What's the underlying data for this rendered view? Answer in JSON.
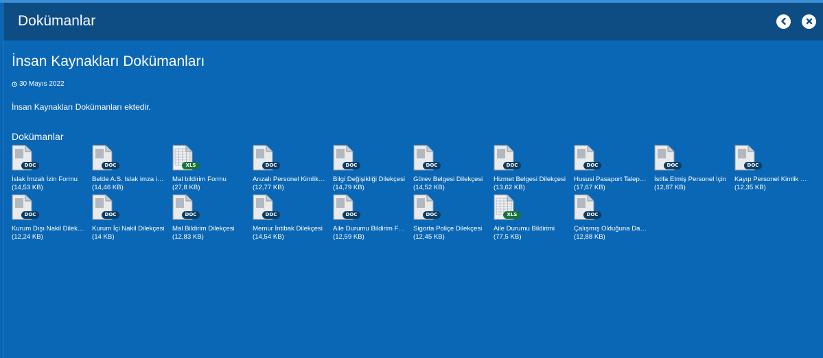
{
  "window": {
    "title": "Dokümanlar",
    "back_icon": "chevron-left-icon",
    "close_icon": "close-icon"
  },
  "page": {
    "title": "İnsan Kaynakları Dokümanları",
    "date": "30 Mayıs 2022",
    "description": "İnsan Kaynakları Dokümanları ektedir.",
    "section_title": "Dokümanlar"
  },
  "colors": {
    "background": "#0a67b5",
    "header": "#0e4d84",
    "doc_badge": "#0b3d66",
    "xls_badge": "#16743a"
  },
  "files": [
    {
      "name": "İslak İmzalı İzin Formu",
      "size": "(14,53 KB)",
      "type": "DOC"
    },
    {
      "name": "Belde A.S. Islak imza izin formu",
      "size": "(14,46 KB)",
      "type": "DOC"
    },
    {
      "name": "Mal bildirim Formu",
      "size": "(27,8 KB)",
      "type": "XLS"
    },
    {
      "name": "Arızalı Personel Kimlik Kartı",
      "size": "(12,77 KB)",
      "type": "DOC"
    },
    {
      "name": "Bilgi Değişikliği Dilekçesi",
      "size": "(14,79 KB)",
      "type": "DOC"
    },
    {
      "name": "Görev Belgesi Dilekçesi",
      "size": "(14,52 KB)",
      "type": "DOC"
    },
    {
      "name": "Hizmet Belgesi Dilekçesi",
      "size": "(13,62 KB)",
      "type": "DOC"
    },
    {
      "name": "Hususi Pasaport Talep Dilekçesi",
      "size": "(17,67 KB)",
      "type": "DOC"
    },
    {
      "name": "İstifa Etmiş Personel İçin",
      "size": "(12,87 KB)",
      "type": "DOC"
    },
    {
      "name": "Kayıp Personel Kimlik Kartı",
      "size": "(12,35 KB)",
      "type": "DOC"
    },
    {
      "name": "Kurum Dışı Nakil Dilekçesi",
      "size": "(12,24 KB)",
      "type": "DOC"
    },
    {
      "name": "Kurum İçi Nakil Dilekçesi",
      "size": "(14 KB)",
      "type": "DOC"
    },
    {
      "name": "Mal Bildirim Dilekçesi",
      "size": "(12,83 KB)",
      "type": "DOC"
    },
    {
      "name": "Memur İntibak Dilekçesi",
      "size": "(14,54 KB)",
      "type": "DOC"
    },
    {
      "name": "Aile Durumu Bildirim Formu",
      "size": "(12,59 KB)",
      "type": "DOC"
    },
    {
      "name": "Sigorta Poliçe Dilekçesi",
      "size": "(12,45 KB)",
      "type": "DOC"
    },
    {
      "name": "Aile Durumu Bildirimi",
      "size": "(77,5 KB)",
      "type": "XLS"
    },
    {
      "name": "Çalışmış Olduğuna Dair Belge",
      "size": "(12,88 KB)",
      "type": "DOC"
    }
  ]
}
